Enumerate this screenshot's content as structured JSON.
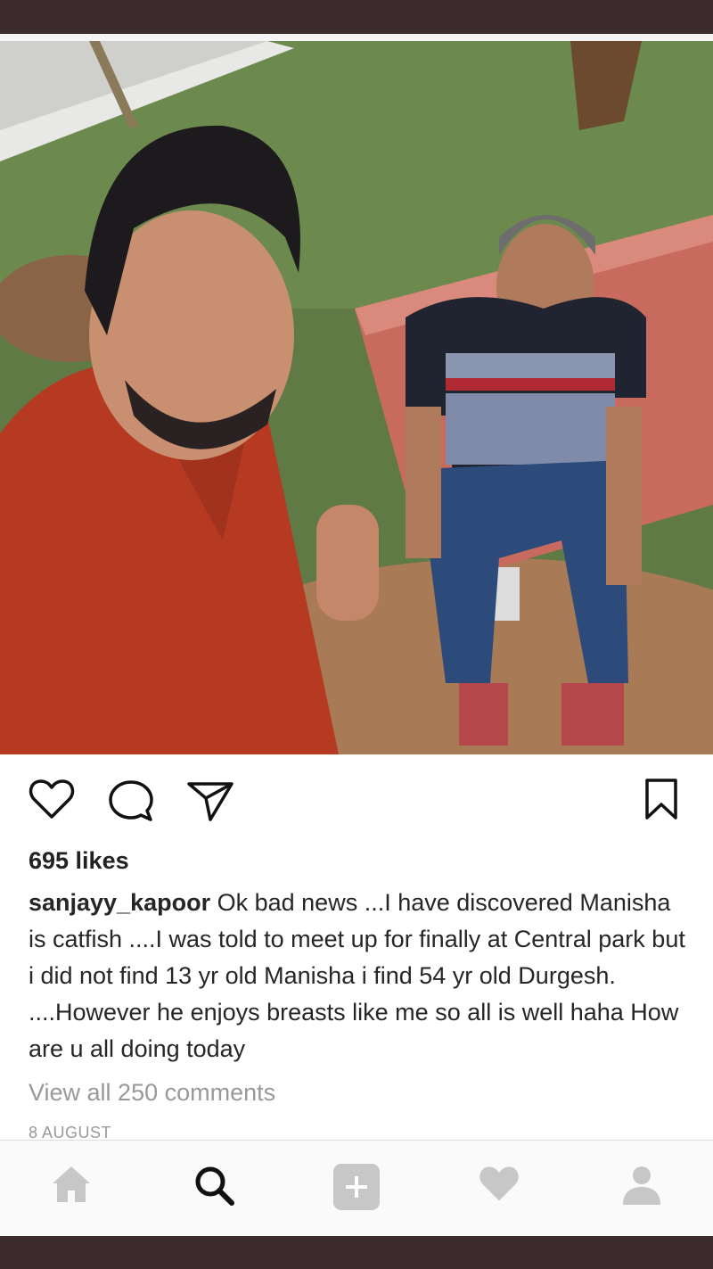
{
  "post": {
    "likes": "695 likes",
    "username": "sanjayy_kapoor",
    "caption": " Ok bad news ...I have discovered Manisha is catfish ....I was told to meet up for finally at Central park but i did not find 13 yr old Manisha i find 54 yr old Durgesh. ....However he enjoys breasts like me so all is well haha How are u all doing today",
    "view_comments": "View all 250 comments",
    "date": "8 AUGUST"
  },
  "icons": {
    "actions": [
      "heart-icon",
      "comment-icon",
      "share-icon",
      "bookmark-icon"
    ],
    "nav": [
      "home-icon",
      "search-icon",
      "add-post-icon",
      "activity-heart-icon",
      "profile-icon"
    ]
  },
  "colors": {
    "frame": "#3b2b2c",
    "text": "#262626",
    "muted": "#999999",
    "nav_inactive": "#c7c7c7"
  }
}
